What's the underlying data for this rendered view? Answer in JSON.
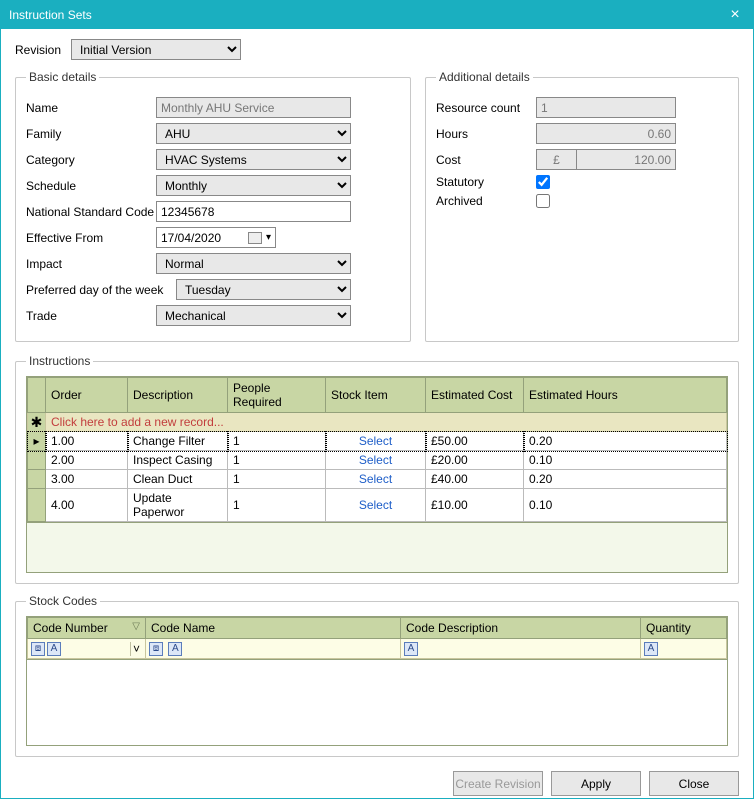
{
  "window": {
    "title": "Instruction Sets"
  },
  "revision": {
    "label": "Revision",
    "value": "Initial Version"
  },
  "basic": {
    "legend": "Basic details",
    "name": {
      "label": "Name",
      "value": "Monthly AHU Service"
    },
    "family": {
      "label": "Family",
      "value": "AHU"
    },
    "category": {
      "label": "Category",
      "value": "HVAC Systems"
    },
    "schedule": {
      "label": "Schedule",
      "value": "Monthly"
    },
    "nsc": {
      "label": "National Standard Code",
      "value": "12345678"
    },
    "effective": {
      "label": "Effective From",
      "value": "17/04/2020"
    },
    "impact": {
      "label": "Impact",
      "value": "Normal"
    },
    "day": {
      "label": "Preferred day of the week",
      "value": "Tuesday"
    },
    "trade": {
      "label": "Trade",
      "value": "Mechanical"
    }
  },
  "additional": {
    "legend": "Additional details",
    "resource": {
      "label": "Resource count",
      "value": "1"
    },
    "hours": {
      "label": "Hours",
      "value": "0.60"
    },
    "cost": {
      "label": "Cost",
      "currency": "£",
      "value": "120.00"
    },
    "statutory": {
      "label": "Statutory",
      "checked": true
    },
    "archived": {
      "label": "Archived",
      "checked": false
    }
  },
  "instructions": {
    "legend": "Instructions",
    "columns": {
      "order": "Order",
      "desc": "Description",
      "people": "People Required",
      "stock": "Stock Item",
      "cost": "Estimated Cost",
      "hours": "Estimated Hours"
    },
    "newrec": "Click here to add a new record...",
    "select_label": "Select",
    "rows": [
      {
        "order": "1.00",
        "desc": "Change Filter",
        "people": "1",
        "cost": "£50.00",
        "hours": "0.20"
      },
      {
        "order": "2.00",
        "desc": "Inspect Casing",
        "people": "1",
        "cost": "£20.00",
        "hours": "0.10"
      },
      {
        "order": "3.00",
        "desc": "Clean Duct",
        "people": "1",
        "cost": "£40.00",
        "hours": "0.20"
      },
      {
        "order": "4.00",
        "desc": "Update Paperwor",
        "people": "1",
        "cost": "£10.00",
        "hours": "0.10"
      }
    ]
  },
  "stock": {
    "legend": "Stock Codes",
    "columns": {
      "num": "Code Number",
      "name": "Code Name",
      "desc": "Code Description",
      "qty": "Quantity"
    }
  },
  "buttons": {
    "create_rev": "Create Revision",
    "apply": "Apply",
    "close": "Close"
  }
}
